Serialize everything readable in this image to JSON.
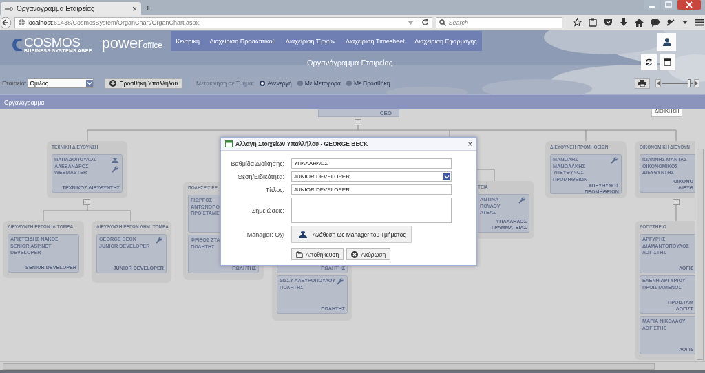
{
  "browser": {
    "tab_title": "Οργανόγραμμα Εταιρείας",
    "tab_close": "×",
    "new_tab": "+",
    "url_host": "localhost",
    "url_path": ":61438/CosmosSystem/OrganChart/OrganChart.aspx",
    "search_placeholder": "Search"
  },
  "header": {
    "brand": "COSMOS",
    "tagline": "BUSINESS SYSTEMS ABEE",
    "product_main": "power",
    "product_sub": "office",
    "nav": [
      "Κεντρική",
      "Διαχείριση Προσωπικού",
      "Διαχείριση Έργων",
      "Διαχείριση Timesheet",
      "Διαχείριση Εφαρμογής"
    ],
    "page_title": "Οργανόγραμμα Εταιρείας"
  },
  "toolbar": {
    "company_label": "Εταιρεία:",
    "company_value": "Όμιλος",
    "add_button": "Προσθήκη Υπαλλήλου",
    "move_label": "Μετακίνηση σε Τμήμα:",
    "move_options": [
      {
        "label": "Ανενεργή",
        "selected": true
      },
      {
        "label": "Με Μεταφορά",
        "selected": false
      },
      {
        "label": "Με Προσθήκη",
        "selected": false
      }
    ],
    "zoom": {
      "level": 0.88
    }
  },
  "panel_title": "Οργανόγραμμα",
  "tooltip": "ΔΙΟΙΚΗΣΗ",
  "ceo": {
    "role": "CEO",
    "expanded": true
  },
  "groups": [
    {
      "title": "ΤΕΧΝΙΚΗ ΔΙΕΥΘΥΝΣΗ",
      "expanded": true,
      "cards": [
        {
          "lines": [
            "ΠΑΠΑΔΟΠΟΥΛΟΣ",
            "ΑΛΕΞΑΝΔΡΟΣ",
            "WEBMASTER"
          ],
          "role": [
            "ΤΕΧΝΙΚΟΣ ΔΙΕΥΘΥΝΤΗΣ"
          ],
          "manager": true,
          "wrench": true
        }
      ]
    },
    {
      "title": "ΔΙΕΥΘΥΝΣΗ ΕΡΓΩΝ ΙΔ.ΤΟΜΕΑ",
      "cards": [
        {
          "lines": [
            "ΑΡΙΣΤΕΙΔΗΣ ΝΑΚΟΣ",
            "SENIOR ASP.NET",
            "DEVELOPER"
          ],
          "role": [
            "SENIOR DEVELOPER"
          ]
        }
      ]
    },
    {
      "title": "ΔΙΕΥΘΥΝΣΗ ΕΡΓΩΝ ΔΗΜ. ΤΟΜΕΑ",
      "cards": [
        {
          "lines": [
            "GEORGE BECK",
            "JUNIOR DEVELOPER"
          ],
          "role": [
            "JUNIOR DEVELOPER"
          ],
          "wrench": true
        }
      ]
    },
    {
      "title": "ΠΟΛΗΣΕΙΣ ΕΞ",
      "cards": [
        {
          "lines": [
            "ΓΙΩΡΓΟΣ",
            "ΑΝΤΩΝΟΠΟ",
            "ΠΡΟΙΣΤΑΜΕ"
          ]
        },
        {
          "lines": [
            "ΦΡΙΞΟΣ ΣΤΑ",
            "ΠΟΛΗΤΗΣ"
          ],
          "role": [
            "ΠΩΛΗΤΗΣ"
          ]
        }
      ]
    },
    {
      "cards": [
        {
          "role": [
            "ΠΩΛΗΤΗΣ"
          ]
        },
        {
          "lines": [
            "ΣΙΣΣΥ ΑΛΕΥΡΟΠΟΥΛΟΥ",
            "ΠΟΛΗΤΗΣ"
          ],
          "role": [
            "ΠΩΛΗΤΗΣ"
          ],
          "wrench": true
        }
      ]
    },
    {
      "title": "ΤΕΙΑ",
      "cards": [
        {
          "lines": [
            "ΑΝΤΙΝΑ",
            "ΠΟΥΛΟΥ",
            "ΑΤΕΑΣ"
          ],
          "role": [
            "ΥΠΑΛΛΗΛΟΣ",
            "ΓΡΑΜΜΑΤΕΙΑΣ"
          ],
          "wrench": true
        }
      ]
    },
    {
      "title": "ΔΙΕΥΘΥΝΣΗ ΠΡΟΜΗΘΕΙΩΝ",
      "cards": [
        {
          "lines": [
            "ΜΑΝΩΛΗΣ",
            "ΜΑΝΩΛΑΚΗΣ",
            "ΥΠΕΥΘΥΝΟΣ",
            "ΠΡΟΜΗΘΕΙΩΝ"
          ],
          "role": [
            "ΥΠΕΥΘΥΝΟΣ",
            "ΠΡΟΜΗΘΕΙΩΝ"
          ],
          "wrench": true
        }
      ]
    },
    {
      "title": "ΟΙΚΟΝΟΜΙΚΗ ΔΙΕΥΘΥΝ",
      "expanded": true,
      "cards": [
        {
          "lines": [
            "ΙΩΑΝΝΗΣ ΜΑΝΤΑΣ",
            "ΟΙΚΟΝΟΜΙΚΟΣ",
            "ΔΙΕΥΘΥΝΤΗΣ"
          ],
          "role": [
            "ΟΙΚΟΝΟ",
            "ΔΙΕΥΘ"
          ]
        }
      ]
    },
    {
      "title": "ΛΟΓΙΣΤΗΡΙΟ",
      "cards": [
        {
          "lines": [
            "ΑΡΓΥΡΗΣ",
            "ΔΙΑΜΑΝΤΟΠΟΥΛΟΣ",
            "ΛΟΓΙΣΤΗΣ"
          ],
          "role": [
            "ΛΟΓΙΣ"
          ]
        },
        {
          "lines": [
            "ΕΛΕΝΗ ΑΡΓΥΡΙΟΥ",
            "ΠΡΟΙΣΤΑΜΕΝΟΣ"
          ],
          "role": [
            "ΠΡΟΙΣΤΑΜ",
            "ΛΟΓΙΣΤ"
          ]
        },
        {
          "lines": [
            "ΜΑΡΙΑ ΝΙΚΟΛΑΟΥ",
            "ΛΟΓΙΣΤΗΣ"
          ],
          "role": [
            "ΛΟΓΙΣ"
          ]
        }
      ]
    }
  ],
  "dialog": {
    "title": "Αλλαγή Στοιχείων Υπαλλήλου - GEORGE BECK",
    "close": "×",
    "fields": [
      {
        "kind": "text",
        "label": "Βαθμίδα Διοίκησης:",
        "value": "ΥΠΑΛΛΗΛΟΣ"
      },
      {
        "kind": "select",
        "label": "Θέση/Ειδικότητα:",
        "value": "JUNIOR DEVELOPER"
      },
      {
        "kind": "text",
        "label": "Τίτλος:",
        "value": "JUNIOR DEVELOPER"
      },
      {
        "kind": "textarea",
        "label": "Σημειώσεις:"
      }
    ],
    "manager_label": "Manager: Όχι",
    "assign_button": "Ανάθεση ως Manager του Τμήματος",
    "buttons": [
      {
        "kind": "save",
        "label": "Αποθήκευση"
      },
      {
        "kind": "cancel",
        "label": "Ακύρωση"
      }
    ]
  }
}
